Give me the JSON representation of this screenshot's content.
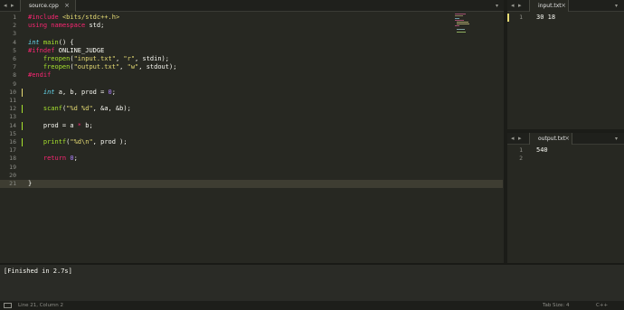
{
  "editor": {
    "tab": "source.cpp",
    "lines": [
      {
        "n": "1",
        "html": "<span class='pp'>#include</span> <span class='st'>&lt;bits/stdc++.h&gt;</span>"
      },
      {
        "n": "2",
        "html": "<span class='kw'>using</span> <span class='kw'>namespace</span> std;"
      },
      {
        "n": "3",
        "html": ""
      },
      {
        "n": "4",
        "html": "<span class='ty'>int</span> <span class='fn'>main</span>() {"
      },
      {
        "n": "5",
        "html": "<span class='pp'>#ifndef</span> ONLINE_JUDGE"
      },
      {
        "n": "6",
        "html": "    <span class='fn'>freopen</span>(<span class='st'>\"input.txt\"</span>, <span class='st'>\"r\"</span>, stdin);"
      },
      {
        "n": "7",
        "html": "    <span class='fn'>freopen</span>(<span class='st'>\"output.txt\"</span>, <span class='st'>\"w\"</span>, stdout);"
      },
      {
        "n": "8",
        "html": "<span class='pp'>#endif</span>"
      },
      {
        "n": "9",
        "html": ""
      },
      {
        "n": "10",
        "html": "    <span class='ty'>int</span> a, b, prod = <span class='nu'>0</span>;"
      },
      {
        "n": "11",
        "html": ""
      },
      {
        "n": "12",
        "html": "    <span class='fn'>scanf</span>(<span class='st'>\"%d %d\"</span>, &amp;a, &amp;b);"
      },
      {
        "n": "13",
        "html": ""
      },
      {
        "n": "14",
        "html": "    prod = a <span class='kw'>*</span> b;"
      },
      {
        "n": "15",
        "html": ""
      },
      {
        "n": "16",
        "html": "    <span class='fn'>printf</span>(<span class='st'>\"%d\\n\"</span>, prod );"
      },
      {
        "n": "17",
        "html": ""
      },
      {
        "n": "18",
        "html": "    <span class='kw'>return</span> <span class='nu'>0</span>;"
      },
      {
        "n": "19",
        "html": ""
      },
      {
        "n": "20",
        "html": ""
      },
      {
        "n": "21",
        "html": "}"
      }
    ]
  },
  "input_pane": {
    "tab": "input.txt",
    "lines": [
      {
        "n": "1",
        "text": "30 18"
      }
    ]
  },
  "output_pane": {
    "tab": "output.txt",
    "lines": [
      {
        "n": "1",
        "text": "540"
      },
      {
        "n": "2",
        "text": ""
      }
    ]
  },
  "console": {
    "text": "[Finished in 2.7s]"
  },
  "status": {
    "position": "Line 21, Column 2",
    "tab_size": "Tab Size: 4",
    "syntax": "C++"
  },
  "colors": {
    "background": "#272822",
    "keyword": "#f92672",
    "type": "#66d9ef",
    "function": "#a6e22e",
    "string": "#e6db74",
    "number": "#ae81ff"
  },
  "icons": {
    "nav_left": "◂",
    "nav_right": "▸",
    "dropdown": "▾",
    "close": "×"
  }
}
